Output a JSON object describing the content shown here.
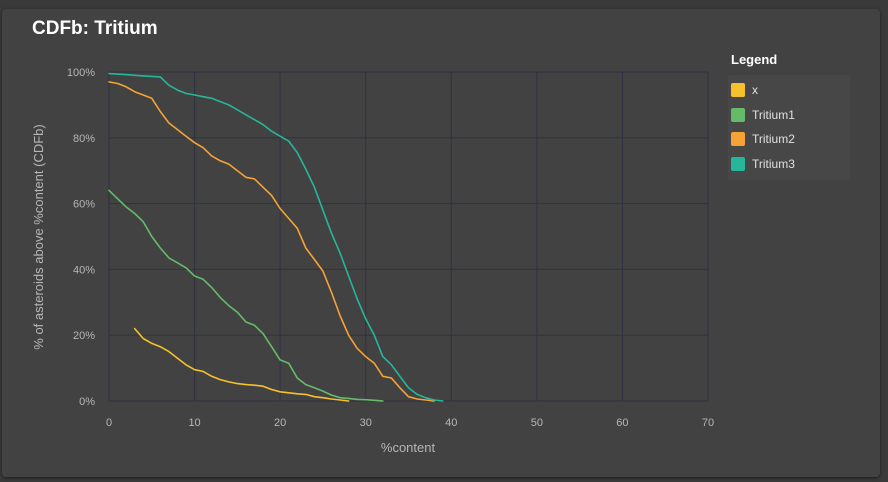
{
  "card": {
    "title": "CDFb: Tritium"
  },
  "legend": {
    "title": "Legend"
  },
  "theme": {
    "grid": "#2f3243",
    "axis_text": "#b7b7b7"
  },
  "chart_data": {
    "type": "line",
    "title": "CDFb: Tritium",
    "xlabel": "%content",
    "ylabel": "% of asteroids above %content (CDFb)",
    "xlim": [
      0,
      70
    ],
    "ylim": [
      0,
      100
    ],
    "xticks": [
      0,
      10,
      20,
      30,
      40,
      50,
      60,
      70
    ],
    "xtick_labels": [
      "0",
      "10",
      "20",
      "30",
      "40",
      "50",
      "60",
      "70"
    ],
    "yticks": [
      0,
      20,
      40,
      60,
      80,
      100
    ],
    "ytick_labels": [
      "0%",
      "20%",
      "40%",
      "60%",
      "80%",
      "100%"
    ],
    "grid": true,
    "legend_position": "right",
    "series": [
      {
        "name": "x",
        "color": "#f6c12b",
        "points": [
          [
            3,
            22
          ],
          [
            4,
            19
          ],
          [
            5,
            17.5
          ],
          [
            6,
            16.5
          ],
          [
            7,
            15
          ],
          [
            8,
            13
          ],
          [
            9,
            11
          ],
          [
            10,
            9.5
          ],
          [
            11,
            9
          ],
          [
            12,
            7.5
          ],
          [
            13,
            6.5
          ],
          [
            14,
            5.8
          ],
          [
            15,
            5.3
          ],
          [
            16,
            5
          ],
          [
            17,
            4.8
          ],
          [
            18,
            4.5
          ],
          [
            19,
            3.5
          ],
          [
            20,
            2.8
          ],
          [
            21,
            2.5
          ],
          [
            22,
            2.2
          ],
          [
            23,
            2
          ],
          [
            24,
            1.3
          ],
          [
            25,
            1
          ],
          [
            26,
            0.6
          ],
          [
            27,
            0.3
          ],
          [
            28,
            0
          ]
        ]
      },
      {
        "name": "Tritium1",
        "color": "#66bb6a",
        "points": [
          [
            0,
            64
          ],
          [
            1,
            61.5
          ],
          [
            2,
            59
          ],
          [
            3,
            57
          ],
          [
            4,
            54.5
          ],
          [
            5,
            50
          ],
          [
            6,
            46.5
          ],
          [
            7,
            43.5
          ],
          [
            8,
            42
          ],
          [
            9,
            40.5
          ],
          [
            10,
            38
          ],
          [
            11,
            37
          ],
          [
            12,
            34.5
          ],
          [
            13,
            31.5
          ],
          [
            14,
            29
          ],
          [
            15,
            27
          ],
          [
            16,
            24
          ],
          [
            17,
            23
          ],
          [
            18,
            20.5
          ],
          [
            19,
            16.5
          ],
          [
            20,
            12.5
          ],
          [
            21,
            11.5
          ],
          [
            22,
            7
          ],
          [
            23,
            5
          ],
          [
            24,
            4
          ],
          [
            25,
            3
          ],
          [
            26,
            1.8
          ],
          [
            27,
            1
          ],
          [
            28,
            0.8
          ],
          [
            29,
            0.5
          ],
          [
            30,
            0.4
          ],
          [
            31,
            0.2
          ],
          [
            32,
            0
          ]
        ]
      },
      {
        "name": "Tritium2",
        "color": "#f7a234",
        "points": [
          [
            0,
            97
          ],
          [
            1,
            96.5
          ],
          [
            2,
            95.5
          ],
          [
            3,
            94
          ],
          [
            4,
            93
          ],
          [
            5,
            92
          ],
          [
            6,
            88
          ],
          [
            7,
            84.5
          ],
          [
            8,
            82.5
          ],
          [
            9,
            80.5
          ],
          [
            10,
            78.5
          ],
          [
            11,
            77
          ],
          [
            12,
            74.5
          ],
          [
            13,
            73
          ],
          [
            14,
            72
          ],
          [
            15,
            70
          ],
          [
            16,
            68
          ],
          [
            17,
            67.5
          ],
          [
            18,
            65
          ],
          [
            19,
            62.5
          ],
          [
            20,
            58.5
          ],
          [
            21,
            55.5
          ],
          [
            22,
            52.5
          ],
          [
            23,
            46.5
          ],
          [
            24,
            43
          ],
          [
            25,
            39.5
          ],
          [
            26,
            33
          ],
          [
            27,
            26
          ],
          [
            28,
            20
          ],
          [
            29,
            16
          ],
          [
            30,
            13.5
          ],
          [
            31,
            11.5
          ],
          [
            32,
            7.5
          ],
          [
            33,
            7
          ],
          [
            34,
            4
          ],
          [
            35,
            1.3
          ],
          [
            36,
            0.6
          ],
          [
            37,
            0.3
          ],
          [
            38,
            0
          ]
        ]
      },
      {
        "name": "Tritium3",
        "color": "#26b79a",
        "points": [
          [
            0,
            99.5
          ],
          [
            2,
            99.2
          ],
          [
            4,
            98.8
          ],
          [
            6,
            98.5
          ],
          [
            7,
            96
          ],
          [
            8,
            94.5
          ],
          [
            9,
            93.5
          ],
          [
            10,
            93
          ],
          [
            11,
            92.5
          ],
          [
            12,
            92
          ],
          [
            13,
            91
          ],
          [
            14,
            90
          ],
          [
            15,
            88.5
          ],
          [
            16,
            87
          ],
          [
            17,
            85.5
          ],
          [
            18,
            84
          ],
          [
            19,
            82
          ],
          [
            20,
            80.5
          ],
          [
            21,
            79
          ],
          [
            22,
            75.5
          ],
          [
            23,
            70.5
          ],
          [
            24,
            65
          ],
          [
            25,
            58
          ],
          [
            26,
            51
          ],
          [
            27,
            45
          ],
          [
            28,
            38
          ],
          [
            29,
            31
          ],
          [
            30,
            25
          ],
          [
            31,
            20
          ],
          [
            32,
            13.5
          ],
          [
            33,
            11
          ],
          [
            34,
            7.5
          ],
          [
            35,
            4
          ],
          [
            36,
            2
          ],
          [
            37,
            1
          ],
          [
            38,
            0.3
          ],
          [
            39,
            0
          ]
        ]
      }
    ]
  }
}
